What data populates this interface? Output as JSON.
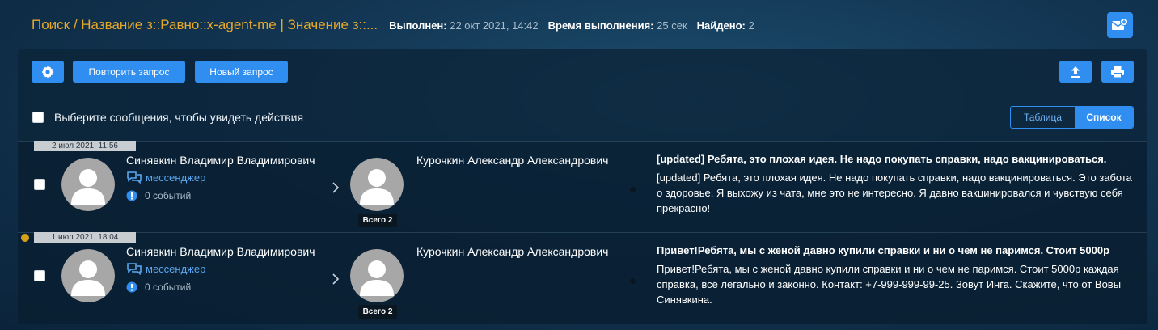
{
  "header": {
    "title": "Поиск / Название з::Равно::x-agent-me | Значение з::...",
    "executed_label": "Выполнен:",
    "executed_value": "22 окт 2021, 14:42",
    "duration_label": "Время выполнения:",
    "duration_value": "25 сек",
    "found_label": "Найдено:",
    "found_value": "2",
    "mail_icon": "mail-add-icon"
  },
  "toolbar": {
    "settings_icon": "gear-icon",
    "repeat_label": "Повторить запрос",
    "new_label": "Новый запрос",
    "upload_icon": "upload-icon",
    "print_icon": "print-icon"
  },
  "selection": {
    "label": "Выберите сообщения, чтобы увидеть действия"
  },
  "view_toggle": {
    "table": "Таблица",
    "list": "Список",
    "active": "list"
  },
  "colors": {
    "accent": "#2f8ef0",
    "title": "#e7a92a",
    "link": "#5aa7f0",
    "marker": "#d6a018"
  },
  "messages": [
    {
      "date": "2 июл 2021, 11:56",
      "marked": false,
      "sender": "Синявкин Владимир Владимирович",
      "channel": "мессенджер",
      "events": "0 событий",
      "receiver": "Курочкин Александр Александрович",
      "total": "Всего 2",
      "subject": "[updated] Ребята, это плохая идея. Не надо покупать справки, надо вакцинироваться.",
      "body": "[updated] Ребята, это плохая идея. Не надо покупать справки, надо вакцинироваться. Это забота о здоровье. Я выхожу из чата, мне это не интересно. Я давно вакцинировался и чувствую себя прекрасно!"
    },
    {
      "date": "1 июл 2021, 18:04",
      "marked": true,
      "sender": "Синявкин Владимир Владимирович",
      "channel": "мессенджер",
      "events": "0 событий",
      "receiver": "Курочкин Александр Александрович",
      "total": "Всего 2",
      "subject": "Привет!Ребята, мы с женой давно купили справки и ни о чем не паримся. Стоит 5000р",
      "body": "Привет!Ребята, мы с женой давно купили справки и ни о чем не паримся. Стоит 5000р каждая справка, всё легально и законно. Контакт: +7-999-999-99-25. Зовут Инга. Скажите, что от Вовы Синявкина."
    }
  ]
}
